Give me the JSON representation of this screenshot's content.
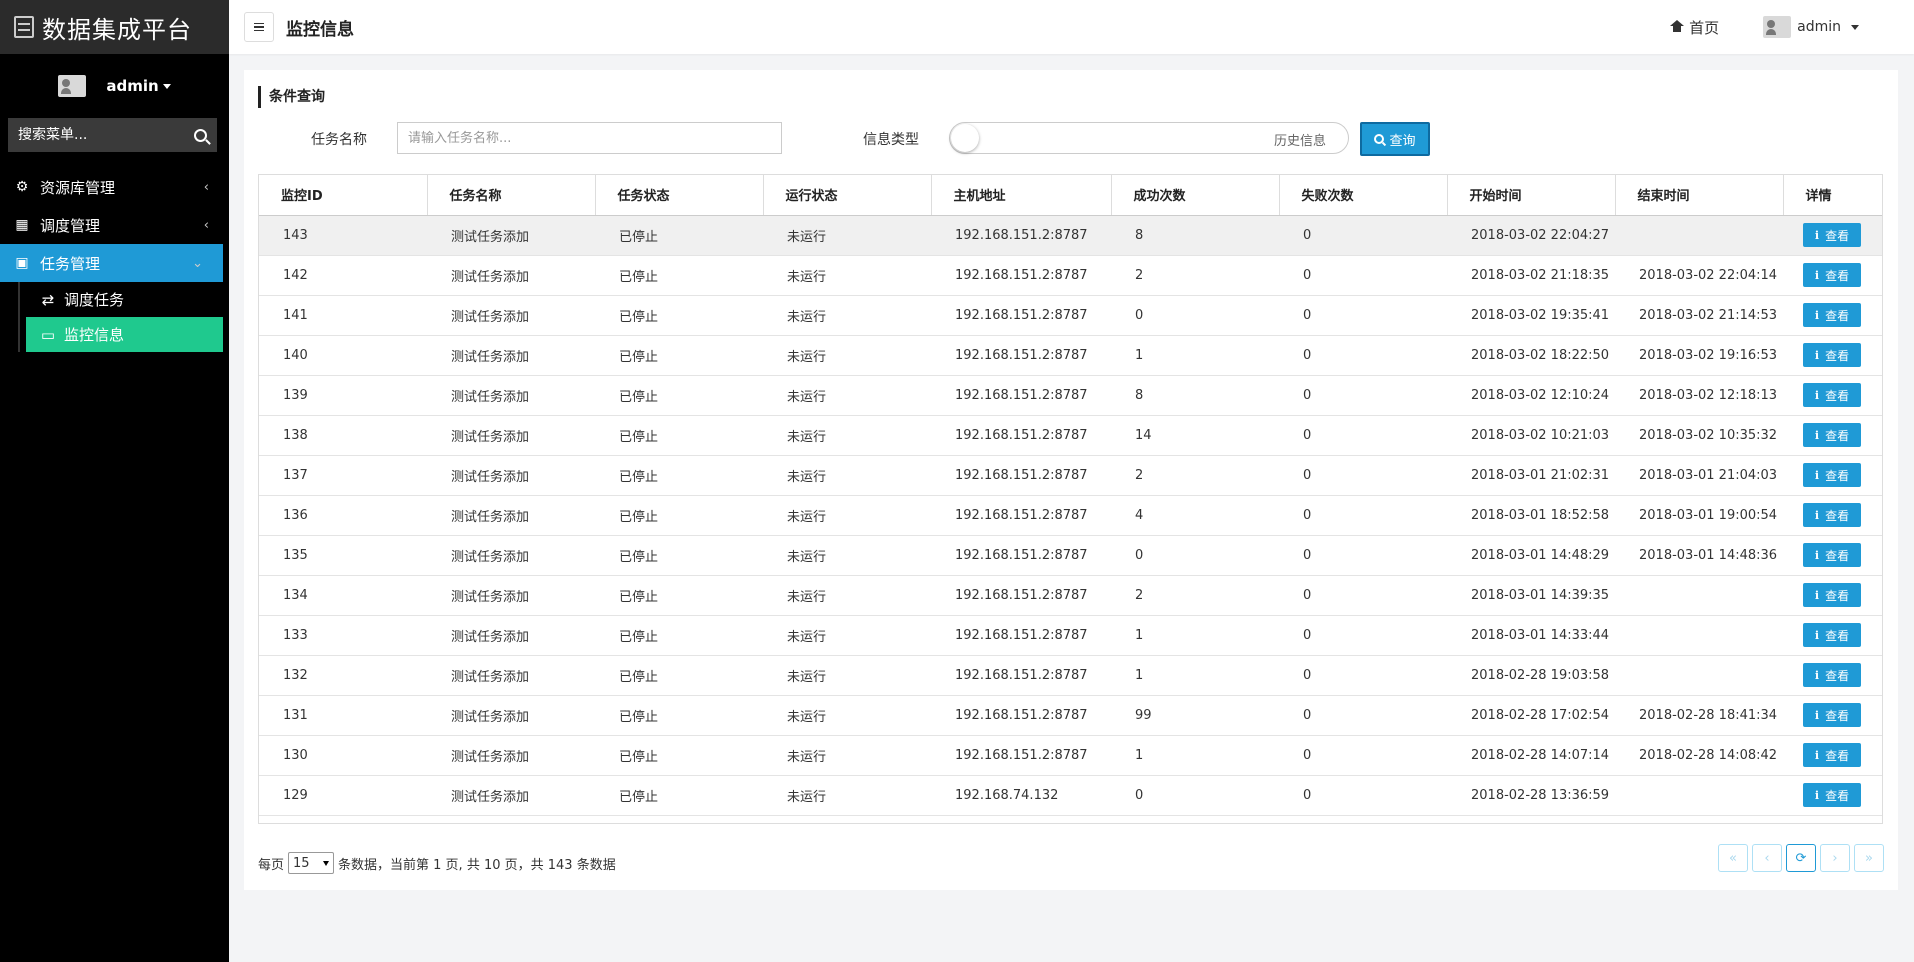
{
  "app": {
    "title": "数据集成平台"
  },
  "sidebar": {
    "user": "admin",
    "search_placeholder": "搜索菜单...",
    "menu": [
      {
        "label": "资源库管理",
        "icon": "sliders-icon"
      },
      {
        "label": "调度管理",
        "icon": "calendar-icon"
      },
      {
        "label": "任务管理",
        "icon": "briefcase-icon",
        "active": true
      }
    ],
    "submenu": [
      {
        "label": "调度任务",
        "icon": "exchange-icon"
      },
      {
        "label": "监控信息",
        "icon": "monitor-icon",
        "selected": true
      }
    ]
  },
  "header": {
    "page_title": "监控信息",
    "home_label": "首页",
    "user": "admin"
  },
  "filter": {
    "section_title": "条件查询",
    "task_name_label": "任务名称",
    "task_name_placeholder": "请输入任务名称...",
    "info_type_label": "信息类型",
    "info_type_value": "历史信息",
    "query_label": "查询"
  },
  "table": {
    "columns": [
      "监控ID",
      "任务名称",
      "任务状态",
      "运行状态",
      "主机地址",
      "成功次数",
      "失败次数",
      "开始时间",
      "结束时间",
      "详情"
    ],
    "view_label": "查看",
    "rows": [
      [
        "143",
        "测试任务添加",
        "已停止",
        "未运行",
        "192.168.151.2:8787",
        "8",
        "0",
        "2018-03-02 22:04:27",
        ""
      ],
      [
        "142",
        "测试任务添加",
        "已停止",
        "未运行",
        "192.168.151.2:8787",
        "2",
        "0",
        "2018-03-02 21:18:35",
        "2018-03-02 22:04:14"
      ],
      [
        "141",
        "测试任务添加",
        "已停止",
        "未运行",
        "192.168.151.2:8787",
        "0",
        "0",
        "2018-03-02 19:35:41",
        "2018-03-02 21:14:53"
      ],
      [
        "140",
        "测试任务添加",
        "已停止",
        "未运行",
        "192.168.151.2:8787",
        "1",
        "0",
        "2018-03-02 18:22:50",
        "2018-03-02 19:16:53"
      ],
      [
        "139",
        "测试任务添加",
        "已停止",
        "未运行",
        "192.168.151.2:8787",
        "8",
        "0",
        "2018-03-02 12:10:24",
        "2018-03-02 12:18:13"
      ],
      [
        "138",
        "测试任务添加",
        "已停止",
        "未运行",
        "192.168.151.2:8787",
        "14",
        "0",
        "2018-03-02 10:21:03",
        "2018-03-02 10:35:32"
      ],
      [
        "137",
        "测试任务添加",
        "已停止",
        "未运行",
        "192.168.151.2:8787",
        "2",
        "0",
        "2018-03-01 21:02:31",
        "2018-03-01 21:04:03"
      ],
      [
        "136",
        "测试任务添加",
        "已停止",
        "未运行",
        "192.168.151.2:8787",
        "4",
        "0",
        "2018-03-01 18:52:58",
        "2018-03-01 19:00:54"
      ],
      [
        "135",
        "测试任务添加",
        "已停止",
        "未运行",
        "192.168.151.2:8787",
        "0",
        "0",
        "2018-03-01 14:48:29",
        "2018-03-01 14:48:36"
      ],
      [
        "134",
        "测试任务添加",
        "已停止",
        "未运行",
        "192.168.151.2:8787",
        "2",
        "0",
        "2018-03-01 14:39:35",
        ""
      ],
      [
        "133",
        "测试任务添加",
        "已停止",
        "未运行",
        "192.168.151.2:8787",
        "1",
        "0",
        "2018-03-01 14:33:44",
        ""
      ],
      [
        "132",
        "测试任务添加",
        "已停止",
        "未运行",
        "192.168.151.2:8787",
        "1",
        "0",
        "2018-02-28 19:03:58",
        ""
      ],
      [
        "131",
        "测试任务添加",
        "已停止",
        "未运行",
        "192.168.151.2:8787",
        "99",
        "0",
        "2018-02-28 17:02:54",
        "2018-02-28 18:41:34"
      ],
      [
        "130",
        "测试任务添加",
        "已停止",
        "未运行",
        "192.168.151.2:8787",
        "1",
        "0",
        "2018-02-28 14:07:14",
        "2018-02-28 14:08:42"
      ],
      [
        "129",
        "测试任务添加",
        "已停止",
        "未运行",
        "192.168.74.132",
        "0",
        "0",
        "2018-02-28 13:36:59",
        ""
      ]
    ]
  },
  "pagination": {
    "per_page_prefix": "每页",
    "page_size": "15",
    "summary": "条数据，当前第 1 页, 共 10 页，共 143 条数据",
    "buttons": [
      "«",
      "‹",
      "⟳",
      "›",
      "»"
    ]
  },
  "colors": {
    "accent": "#1f9ad6",
    "selected": "#1fc98e",
    "sidebar_bg": "#000000"
  }
}
